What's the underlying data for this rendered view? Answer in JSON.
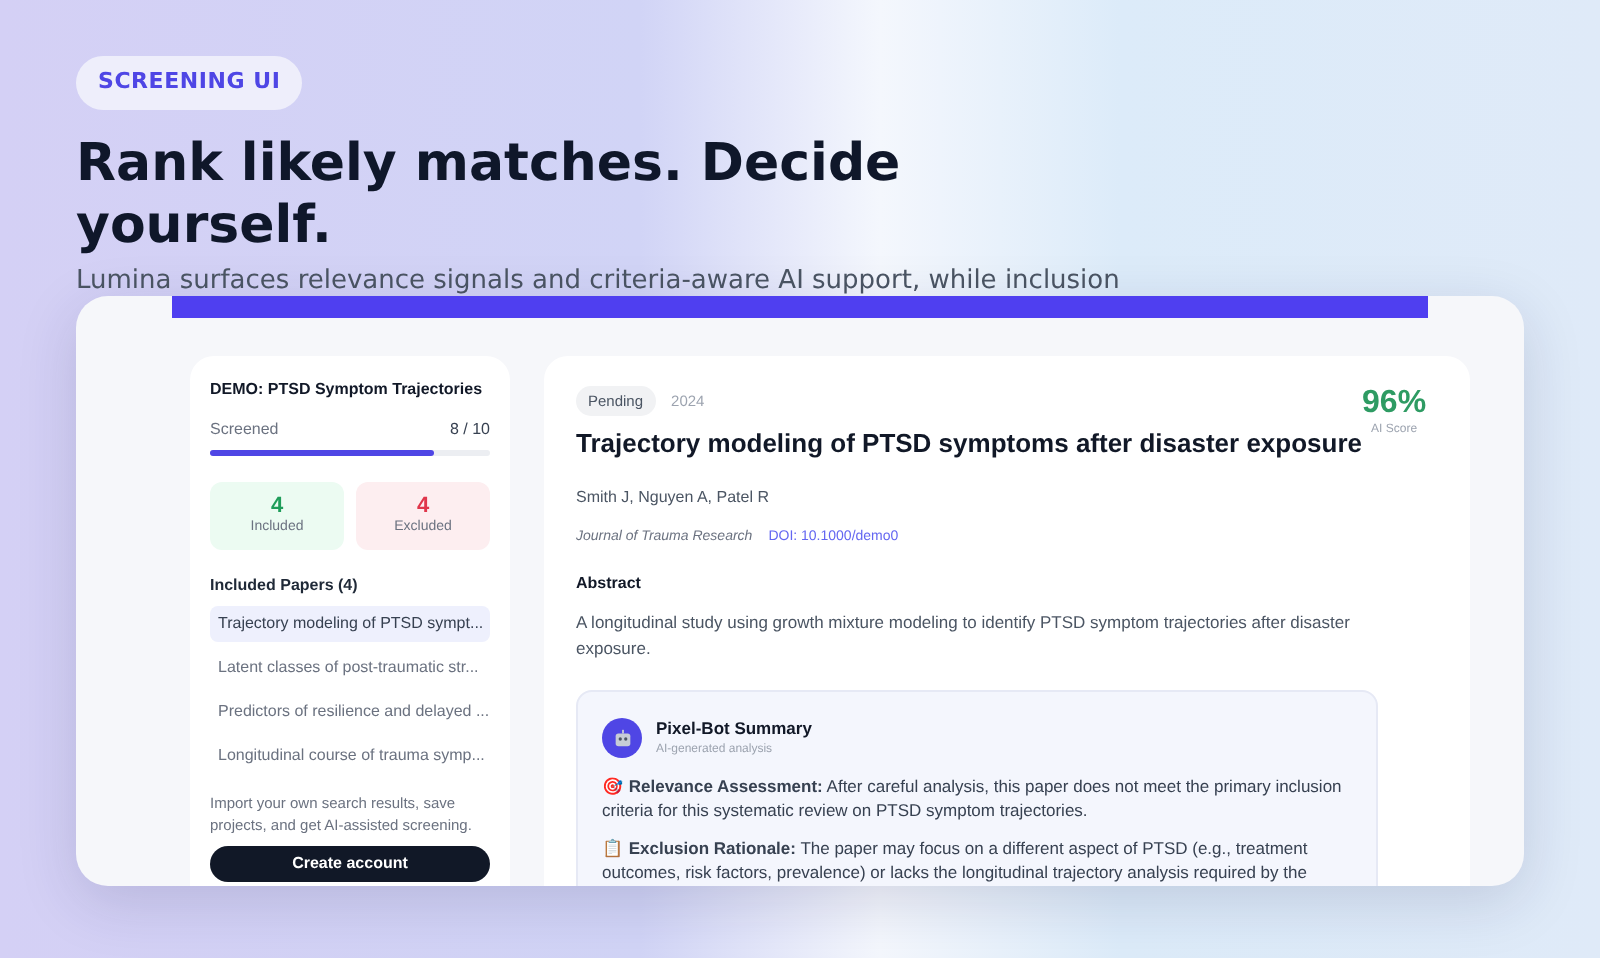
{
  "badge": "SCREENING UI",
  "headline": "Rank likely matches. Decide yourself.",
  "subtitle": "Lumina surfaces relevance signals and criteria-aware AI support, while inclusion",
  "sidebar": {
    "project": "DEMO: PTSD Symptom Trajectories",
    "progress_label": "Screened",
    "progress_count": "8 / 10",
    "level": 0.8,
    "stats": [
      {
        "kind": "included",
        "value": "4",
        "label": "Included"
      },
      {
        "kind": "excluded",
        "value": "4",
        "label": "Excluded"
      }
    ],
    "list_title": "Included Papers (4)",
    "papers": [
      {
        "title": "Trajectory modeling of PTSD sympt...",
        "selected": true
      },
      {
        "title": "Latent classes of post-traumatic str...",
        "selected": false
      },
      {
        "title": "Predictors of resilience and delayed ...",
        "selected": false
      },
      {
        "title": "Longitudinal course of trauma symp...",
        "selected": false
      }
    ],
    "promo": "Import your own search results, save projects, and get AI-assisted screening.",
    "button": "Create account"
  },
  "paper": {
    "status": "Pending",
    "year": "2024",
    "score": "96%",
    "score_label": "AI Score",
    "title": "Trajectory modeling of PTSD symptoms after disaster exposure",
    "authors": "Smith J, Nguyen A, Patel R",
    "journal": "Journal of Trauma Research",
    "doi": "DOI: 10.1000/demo0",
    "abstract_heading": "Abstract",
    "abstract": "A longitudinal study using growth mixture modeling to identify PTSD symptom trajectories after disaster exposure.",
    "summary": {
      "title": "Pixel-Bot Summary",
      "subtitle": "AI-generated analysis",
      "points": [
        {
          "icon": "🎯",
          "text": "**Relevance Assessment:** After careful analysis, this paper does not meet the primary inclusion criteria for this systematic review on PTSD symptom trajectories."
        },
        {
          "icon": "📋",
          "text": "**Exclusion Rationale:** The paper may focus on a different aspect of PTSD (e.g., treatment outcomes, risk factors, prevalence) or lacks the longitudinal trajectory analysis required by the"
        }
      ]
    }
  }
}
